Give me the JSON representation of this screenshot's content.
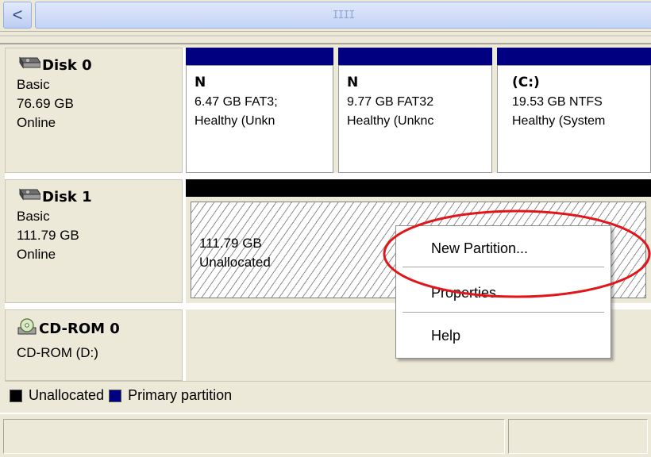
{
  "scrollbar": {
    "left_arrow": "<",
    "grip": "IIII"
  },
  "disks": [
    {
      "icon": "hard-disk-icon",
      "title": "Disk 0",
      "type": "Basic",
      "size": "76.69 GB",
      "status": "Online",
      "partitions": [
        {
          "name": "N",
          "info": "6.47 GB FAT3;",
          "health": "Healthy (Unkn"
        },
        {
          "name": "N",
          "info": "9.77 GB FAT32",
          "health": "Healthy (Unknc"
        },
        {
          "name": "(C:)",
          "info": "19.53 GB NTFS",
          "health": "Healthy (System"
        }
      ]
    },
    {
      "icon": "hard-disk-icon",
      "title": "Disk 1",
      "type": "Basic",
      "size": "111.79 GB",
      "status": "Online",
      "unallocated": {
        "size": "111.79 GB",
        "label": "Unallocated"
      }
    },
    {
      "icon": "cd-rom-icon",
      "title": "CD-ROM 0",
      "type": "CD-ROM (D:)"
    }
  ],
  "legend": [
    {
      "label": "Unallocated",
      "color": "#000000"
    },
    {
      "label": "Primary partition",
      "color": "#000080"
    }
  ],
  "context_menu": {
    "items": [
      "New Partition...",
      "Properties",
      "Help"
    ]
  },
  "colors": {
    "primary_partition_bar": "#000080",
    "unallocated_bar": "#000000",
    "annotation_ellipse": "#e0161b"
  }
}
